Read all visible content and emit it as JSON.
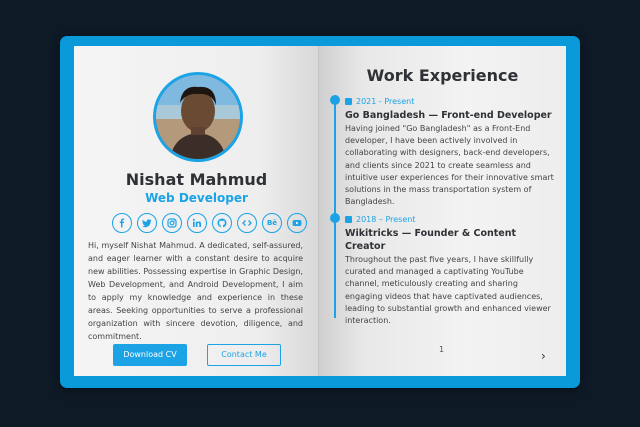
{
  "profile": {
    "name": "Nishat Mahmud",
    "role": "Web Developer",
    "bio": "Hi, myself Nishat Mahmud. A dedicated, self-assured, and eager learner with a constant desire to acquire new abilities. Possessing expertise in Graphic Design, Web Development, and Android Development, I aim to apply my knowledge and experience in these areas. Seeking opportunities to serve a professional organization with sincere devotion, diligence, and commitment.",
    "download_label": "Download CV",
    "contact_label": "Contact Me",
    "socials": [
      "facebook-icon",
      "twitter-icon",
      "instagram-icon",
      "linkedin-icon",
      "github-icon",
      "code-icon",
      "behance-icon",
      "youtube-icon"
    ],
    "behance_text": "Bē"
  },
  "experience": {
    "title": "Work Experience",
    "jobs": [
      {
        "date": "2021 - Present",
        "title": "Go Bangladesh — Front-end Developer",
        "desc": "Having joined \"Go Bangladesh\" as a Front-End developer, I have been actively involved in collaborating with designers, back-end developers, and clients since 2021 to create seamless and intuitive user experiences for their innovative smart solutions in the mass transportation system of Bangladesh."
      },
      {
        "date": "2018 – Present",
        "title": "Wikitricks — Founder & Content Creator",
        "desc": "Throughout the past five years, I have skillfully curated and managed a captivating YouTube channel, meticulously creating and sharing engaging videos that have captivated audiences, leading to substantial growth and enhanced viewer interaction."
      }
    ],
    "page_number": "1",
    "next_glyph": "›"
  },
  "colors": {
    "accent": "#1ba3e6",
    "background": "#0e1a26",
    "book": "#0a9ad9"
  }
}
